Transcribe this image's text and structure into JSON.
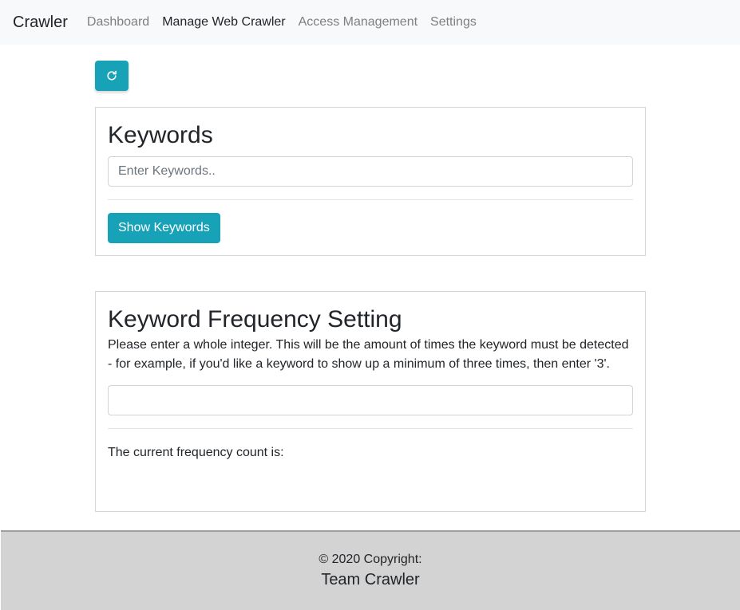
{
  "navbar": {
    "brand": "Crawler",
    "links": [
      {
        "label": "Dashboard",
        "active": false
      },
      {
        "label": "Manage Web Crawler",
        "active": true
      },
      {
        "label": "Access Management",
        "active": false
      },
      {
        "label": "Settings",
        "active": false
      }
    ]
  },
  "refresh": {
    "icon": "refresh-icon"
  },
  "keywords": {
    "title": "Keywords",
    "placeholder": "Enter Keywords..",
    "value": "",
    "button_label": "Show Keywords"
  },
  "frequency": {
    "title": "Keyword Frequency Setting",
    "description": "Please enter a whole integer. This will be the amount of times the keyword must be detected - for example, if you'd like a keyword to show up a minimum of three times, then enter '3'.",
    "value": "",
    "current_label": "The current frequency count is:"
  },
  "footer": {
    "copyright": "© 2020 Copyright:",
    "team": "Team Crawler"
  },
  "colors": {
    "accent": "#17a2b8",
    "navbar_bg": "#f8f9fa",
    "footer_bg": "#d3d3d3"
  }
}
